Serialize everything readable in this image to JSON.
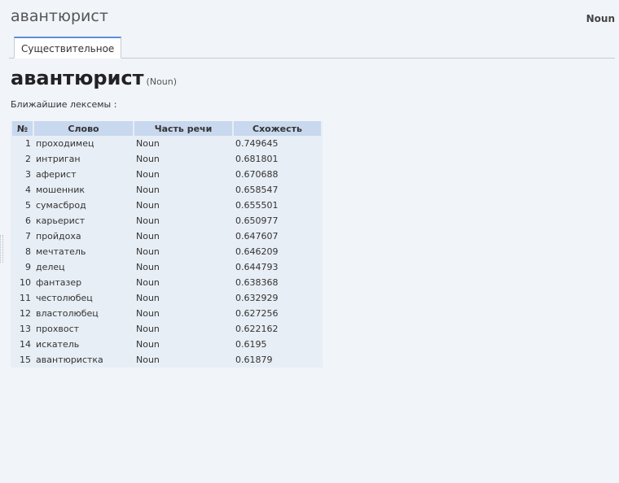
{
  "header": {
    "title": "авантюрист",
    "pos_label": "Noun"
  },
  "tabs": [
    {
      "label": "Существительное",
      "active": true
    }
  ],
  "entry": {
    "word": "авантюрист",
    "pos": "(Noun)",
    "nearest_label": "Ближайшие лексемы :"
  },
  "table": {
    "headers": [
      "№",
      "Слово",
      "Часть речи",
      "Схожесть"
    ],
    "rows": [
      {
        "n": "1",
        "word": "проходимец",
        "pos": "Noun",
        "sim": "0.749645"
      },
      {
        "n": "2",
        "word": "интриган",
        "pos": "Noun",
        "sim": "0.681801"
      },
      {
        "n": "3",
        "word": "аферист",
        "pos": "Noun",
        "sim": "0.670688"
      },
      {
        "n": "4",
        "word": "мошенник",
        "pos": "Noun",
        "sim": "0.658547"
      },
      {
        "n": "5",
        "word": "сумасброд",
        "pos": "Noun",
        "sim": "0.655501"
      },
      {
        "n": "6",
        "word": "карьерист",
        "pos": "Noun",
        "sim": "0.650977"
      },
      {
        "n": "7",
        "word": "пройдоха",
        "pos": "Noun",
        "sim": "0.647607"
      },
      {
        "n": "8",
        "word": "мечтатель",
        "pos": "Noun",
        "sim": "0.646209"
      },
      {
        "n": "9",
        "word": "делец",
        "pos": "Noun",
        "sim": "0.644793"
      },
      {
        "n": "10",
        "word": "фантазер",
        "pos": "Noun",
        "sim": "0.638368"
      },
      {
        "n": "11",
        "word": "честолюбец",
        "pos": "Noun",
        "sim": "0.632929"
      },
      {
        "n": "12",
        "word": "властолюбец",
        "pos": "Noun",
        "sim": "0.627256"
      },
      {
        "n": "13",
        "word": "прохвост",
        "pos": "Noun",
        "sim": "0.622162"
      },
      {
        "n": "14",
        "word": "искатель",
        "pos": "Noun",
        "sim": "0.6195"
      },
      {
        "n": "15",
        "word": "авантюристка",
        "pos": "Noun",
        "sim": "0.61879"
      }
    ]
  },
  "colors": {
    "background": "#f1f4f9",
    "table_header": "#c8d8ee",
    "table_body": "#e8eef6",
    "tab_accent": "#5b8ed6"
  }
}
